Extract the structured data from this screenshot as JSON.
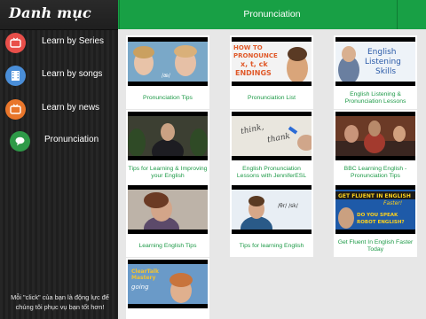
{
  "sidebar": {
    "title": "Danh mục",
    "items": [
      {
        "label": "Learn by Series",
        "icon": "tv-icon",
        "color": "#e94f4a"
      },
      {
        "label": "Learn by songs",
        "icon": "film-icon",
        "color": "#4a8ed8"
      },
      {
        "label": "Learn by news",
        "icon": "tv-icon",
        "color": "#e9762b"
      },
      {
        "label": "Pronunciation",
        "icon": "chat-bubble-icon",
        "color": "#2e9a48"
      }
    ],
    "footer_line1": "Mỗi \"click\" của bạn là động lực để",
    "footer_line2": "chúng tôi phục vụ bạn tốt hơn!"
  },
  "header": {
    "title": "Pronunciation",
    "accent": "#18a045"
  },
  "videos": [
    {
      "caption": "Pronunciation Tips",
      "thumb_text": "/æ/"
    },
    {
      "caption": "Pronunciation List",
      "thumb_text": "HOW TO PRONOUNCE x, t, ck ENDINGS"
    },
    {
      "caption": "English Listening & Pronunciation Lessons",
      "thumb_text": "English Listening Skills"
    },
    {
      "caption": "Tips for Learning & Improving your English",
      "thumb_text": ""
    },
    {
      "caption": "English Pronunciation Lessons with JenniferESL",
      "thumb_text": "think, thank"
    },
    {
      "caption": "BBC Learning English - Pronunciation Tips",
      "thumb_text": ""
    },
    {
      "caption": "Learning English Tips",
      "thumb_text": ""
    },
    {
      "caption": "Tips for learning English",
      "thumb_text": "/θr/ /sk/"
    },
    {
      "caption": "Get Fluent In English Faster Today",
      "thumb_text": "GET FLUENT IN ENGLISH Faster! DO YOU SPEAK ROBOT ENGLISH?"
    },
    {
      "caption": "",
      "thumb_text": "ClearTalk Mastery going"
    }
  ]
}
